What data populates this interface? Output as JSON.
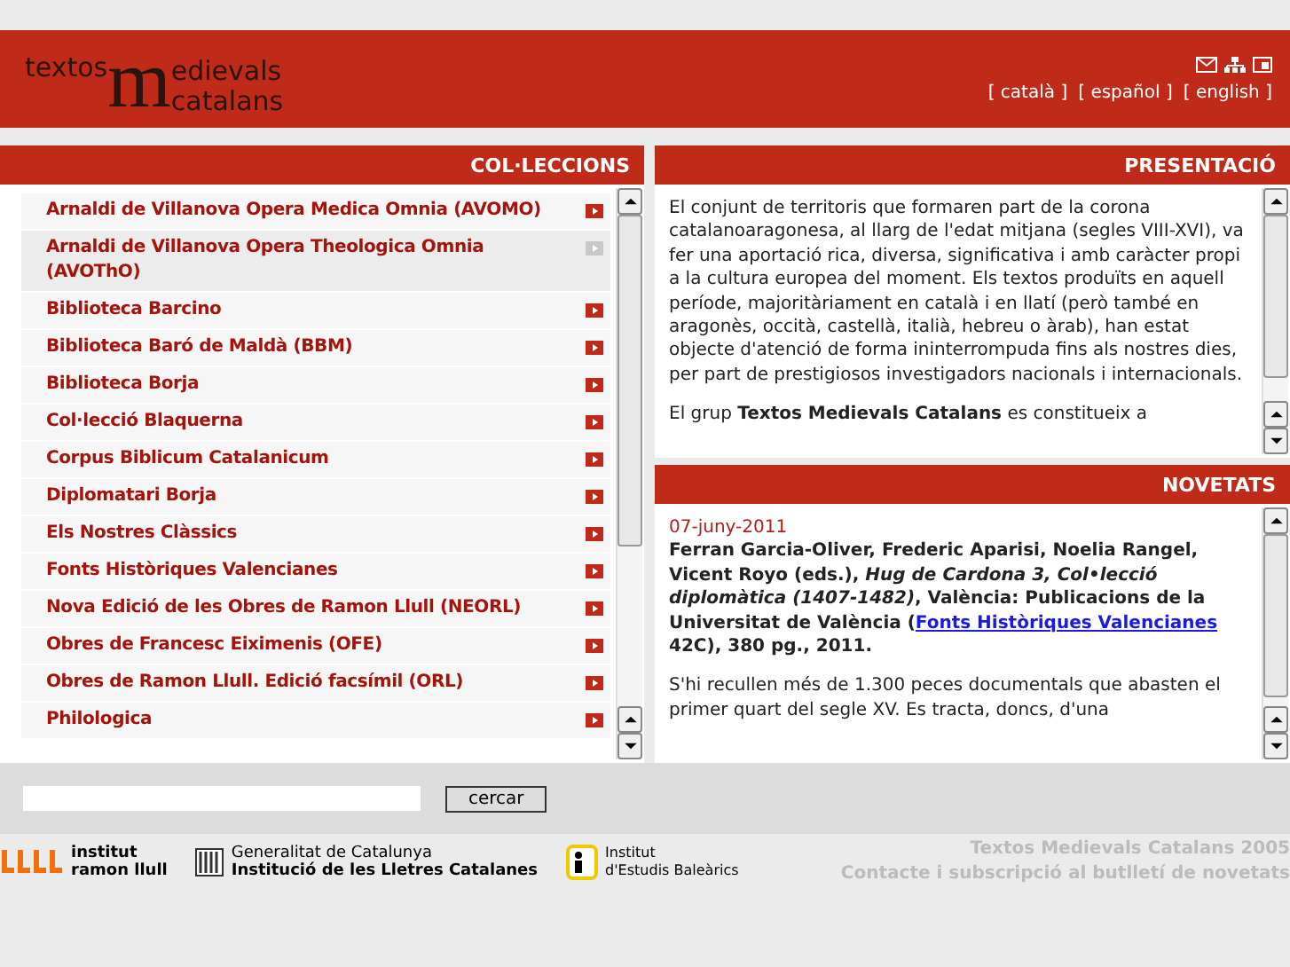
{
  "header": {
    "logo": {
      "pre": "textos",
      "letter": "m",
      "post": "edievals",
      "line2": "catalans"
    },
    "brackets": [
      "[",
      "]"
    ],
    "languages": [
      {
        "label": "català"
      },
      {
        "label": "español"
      },
      {
        "label": "english"
      }
    ]
  },
  "collections": {
    "title": "COL·LECCIONS",
    "items": [
      {
        "label": "Arnaldi de Villanova Opera Medica Omnia (AVOMO)",
        "selected": false
      },
      {
        "label": "Arnaldi de Villanova Opera Theologica Omnia (AVOThO)",
        "selected": true
      },
      {
        "label": "Biblioteca Barcino",
        "selected": false
      },
      {
        "label": "Biblioteca Baró de Maldà (BBM)",
        "selected": false
      },
      {
        "label": "Biblioteca Borja",
        "selected": false
      },
      {
        "label": "Col·lecció Blaquerna",
        "selected": false
      },
      {
        "label": "Corpus Biblicum Catalanicum",
        "selected": false
      },
      {
        "label": "Diplomatari Borja",
        "selected": false
      },
      {
        "label": "Els Nostres Clàssics",
        "selected": false
      },
      {
        "label": "Fonts Històriques Valencianes",
        "selected": false
      },
      {
        "label": "Nova Edició de les Obres de Ramon Llull (NEORL)",
        "selected": false
      },
      {
        "label": "Obres de Francesc Eiximenis (OFE)",
        "selected": false
      },
      {
        "label": "Obres de Ramon Llull. Edició facsímil (ORL)",
        "selected": false
      },
      {
        "label": "Philologica",
        "selected": false
      }
    ]
  },
  "presentation": {
    "title": "PRESENTACIÓ",
    "paragraphs": [
      "El conjunt de territoris que formaren part de la corona catalanoaragonesa, al llarg de l'edat mitjana (segles VIII-XVI), va fer una aportació rica, diversa, significativa i amb caràcter propi a la cultura europea del moment. Els textos produïts en aquell període, majoritàriament en català i en llatí (però també en aragonès, occità, castellà, italià, hebreu o àrab), han estat objecte d'atenció de forma ininterrompuda fins als nostres dies, per part de prestigiosos investigadors nacionals i internacionals.",
      "El grup **Textos Medievals Catalans** es constitueix a"
    ]
  },
  "news": {
    "title": "NOVETATS",
    "date": "07-juny-2011",
    "entry_before": "Ferran Garcia-Oliver, Frederic Aparisi, Noelia Rangel, Vicent Royo (eds.), *Hug de Cardona 3, Col•lecció diplomàtica (1407-1482)*, València: Publicacions de la Universitat de València (",
    "entry_link": "Fonts Històriques Valencianes",
    "entry_after": " 42C), 380 pg., 2011.",
    "paragraph": "S'hi recullen més de 1.300 peces documentals que abasten el primer quart del segle XV. Es tracta, doncs, d'una"
  },
  "search": {
    "button": "cercar"
  },
  "sponsors": {
    "irl": [
      "institut",
      "ramon llull"
    ],
    "gen": [
      "Generalitat de Catalunya",
      "Institució de les Lletres Catalanes"
    ],
    "ieb": [
      "Institut",
      "d'Estudis Baleàrics"
    ]
  },
  "footer": {
    "copyright": "Textos Medievals Catalans 2005",
    "contact": "Contacte i subscripció al butlletí de novetats"
  }
}
